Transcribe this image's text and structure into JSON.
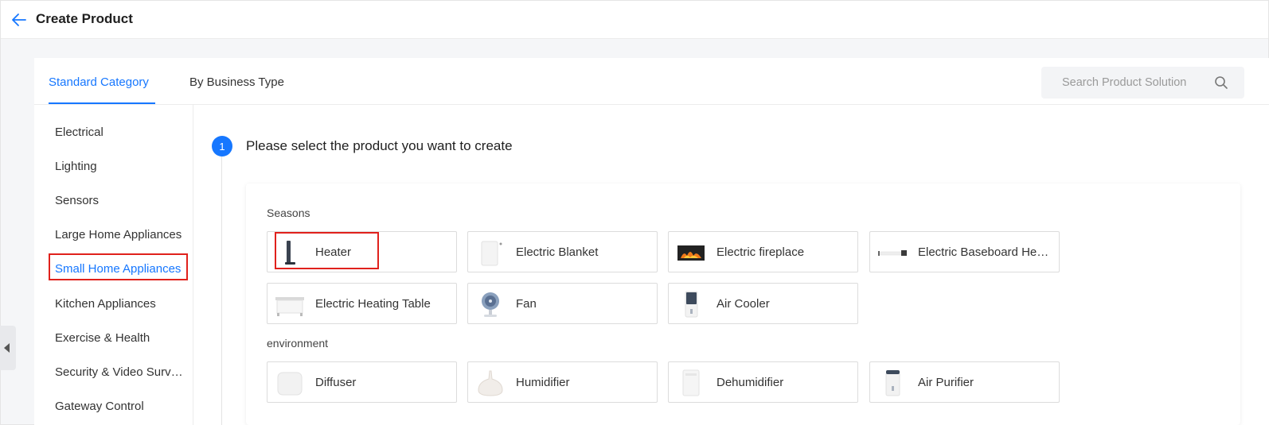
{
  "header": {
    "title": "Create Product"
  },
  "tabs": [
    {
      "label": "Standard Category",
      "active": true
    },
    {
      "label": "By Business Type",
      "active": false
    }
  ],
  "search": {
    "placeholder": "Search Product Solution",
    "value": ""
  },
  "sidebar": {
    "items": [
      {
        "label": "Electrical"
      },
      {
        "label": "Lighting"
      },
      {
        "label": "Sensors"
      },
      {
        "label": "Large Home Appliances"
      },
      {
        "label": "Small Home Appliances",
        "active": true
      },
      {
        "label": "Kitchen Appliances"
      },
      {
        "label": "Exercise & Health"
      },
      {
        "label": "Security & Video Surveillance"
      },
      {
        "label": "Gateway Control"
      }
    ]
  },
  "step": {
    "number": "1",
    "title": "Please select the product you want to create"
  },
  "sections": [
    {
      "label": "Seasons",
      "products": [
        {
          "name": "Heater",
          "icon": "heater-icon"
        },
        {
          "name": "Electric Blanket",
          "icon": "electric-blanket-icon"
        },
        {
          "name": "Electric fireplace",
          "icon": "electric-fireplace-icon"
        },
        {
          "name": "Electric Baseboard Heater",
          "icon": "baseboard-heater-icon"
        },
        {
          "name": "Electric Heating Table",
          "icon": "heating-table-icon"
        },
        {
          "name": "Fan",
          "icon": "fan-icon"
        },
        {
          "name": "Air Cooler",
          "icon": "air-cooler-icon"
        }
      ]
    },
    {
      "label": "environment",
      "products": [
        {
          "name": "Diffuser",
          "icon": "diffuser-icon"
        },
        {
          "name": "Humidifier",
          "icon": "humidifier-icon"
        },
        {
          "name": "Dehumidifier",
          "icon": "dehumidifier-icon"
        },
        {
          "name": "Air Purifier",
          "icon": "air-purifier-icon"
        }
      ]
    }
  ],
  "colors": {
    "accent": "#1677ff",
    "highlight": "#e0211c"
  }
}
